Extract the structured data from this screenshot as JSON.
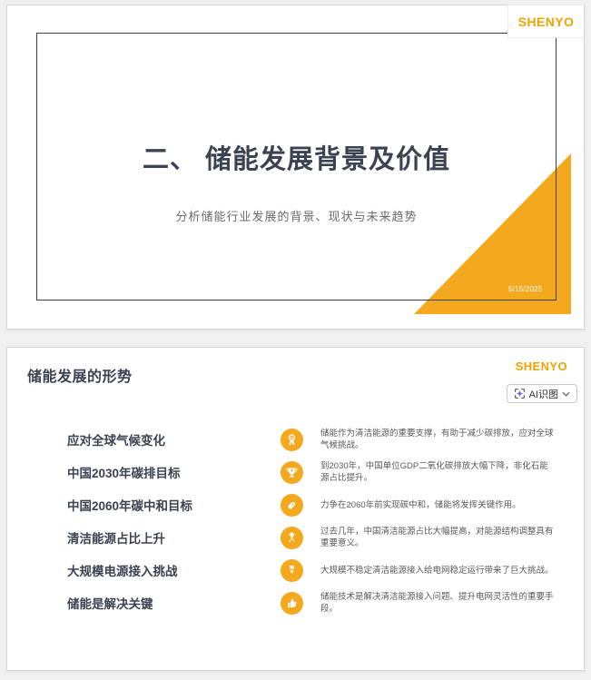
{
  "brand": {
    "name": "SHENYO",
    "color": "#F0A202"
  },
  "accent_color": "#F4A81D",
  "slide1": {
    "title": "二、 储能发展背景及价值",
    "subtitle": "分析储能行业发展的背景、现状与未来趋势",
    "date": "5/15/2025"
  },
  "slide2": {
    "title": "储能发展的形势",
    "ai_button": {
      "label": "AI识图",
      "icon": "sparkle-scan-icon",
      "chevron": "chevron-down-icon",
      "sparkle_color": "#7B5BF5"
    },
    "rows": [
      {
        "label": "应对全球气候变化",
        "icon": "award-rosette-icon",
        "desc": "储能作为清洁能源的重要支撑，有助于减少碳排放，应对全球气候挑战。"
      },
      {
        "label": "中国2030年碳排目标",
        "icon": "trophy-icon",
        "desc": "到2030年，中国单位GDP二氧化碳排放大幅下降，非化石能源占比提升。"
      },
      {
        "label": "中国2060年碳中和目标",
        "icon": "tag-icon",
        "desc": "力争在2060年前实现碳中和，储能将发挥关键作用。"
      },
      {
        "label": "清洁能源占比上升",
        "icon": "crossed-flags-icon",
        "desc": "过去几年，中国清洁能源占比大幅提高，对能源结构调整具有重要意义。"
      },
      {
        "label": "大规模电源接入挑战",
        "icon": "medal-icon",
        "desc": "大规模不稳定清洁能源接入给电网稳定运行带来了巨大挑战。"
      },
      {
        "label": "储能是解决关键",
        "icon": "thumbs-up-icon",
        "desc": "储能技术是解决清洁能源接入问题、提升电网灵活性的重要手段。"
      }
    ]
  }
}
